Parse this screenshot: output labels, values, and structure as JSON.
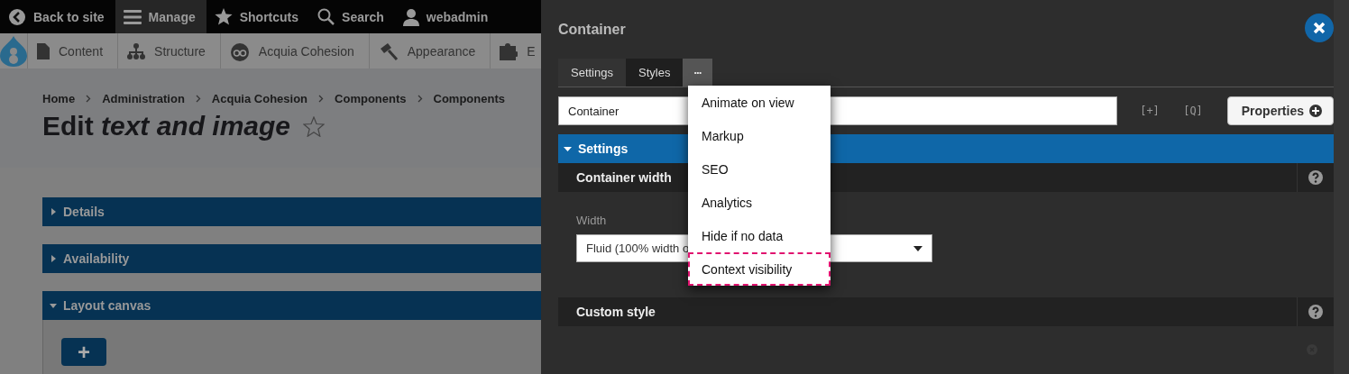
{
  "toolbar": {
    "items": [
      {
        "label": "Back to site",
        "selected": false
      },
      {
        "label": "Manage",
        "selected": true
      },
      {
        "label": "Shortcuts",
        "selected": false
      },
      {
        "label": "Search",
        "selected": false
      },
      {
        "label": "webadmin",
        "selected": false
      }
    ]
  },
  "admin_menu": {
    "items": [
      {
        "label": "Content"
      },
      {
        "label": "Structure"
      },
      {
        "label": "Acquia Cohesion"
      },
      {
        "label": "Appearance"
      },
      {
        "label": "E"
      }
    ]
  },
  "breadcrumb": [
    "Home",
    "Administration",
    "Acquia Cohesion",
    "Components",
    "Components"
  ],
  "page_title": "Edit *text and image*",
  "sections": [
    {
      "label": "Details",
      "expanded": false
    },
    {
      "label": "Availability",
      "expanded": false
    },
    {
      "label": "Layout canvas",
      "expanded": true
    }
  ],
  "add_button": "+",
  "panel": {
    "title": "Container",
    "tabs": [
      {
        "label": "Settings",
        "selected": true
      },
      {
        "label": "Styles",
        "selected": false
      }
    ],
    "more_button": "•••",
    "name_field": {
      "value": "Container"
    },
    "expand_all": "[+]",
    "actions": "[Q]",
    "properties_button": "Properties",
    "settings_header": "Settings",
    "groups": [
      {
        "title": "Container width",
        "field_label": "Width",
        "select_value": "Fluid (100% width o"
      },
      {
        "title": "Custom style"
      }
    ],
    "menu": [
      {
        "label": "Animate on view",
        "focused": false
      },
      {
        "label": "Markup",
        "focused": false
      },
      {
        "label": "SEO",
        "focused": false
      },
      {
        "label": "Analytics",
        "focused": false
      },
      {
        "label": "Hide if no data",
        "focused": false
      },
      {
        "label": "Context visibility",
        "focused": true
      }
    ]
  }
}
